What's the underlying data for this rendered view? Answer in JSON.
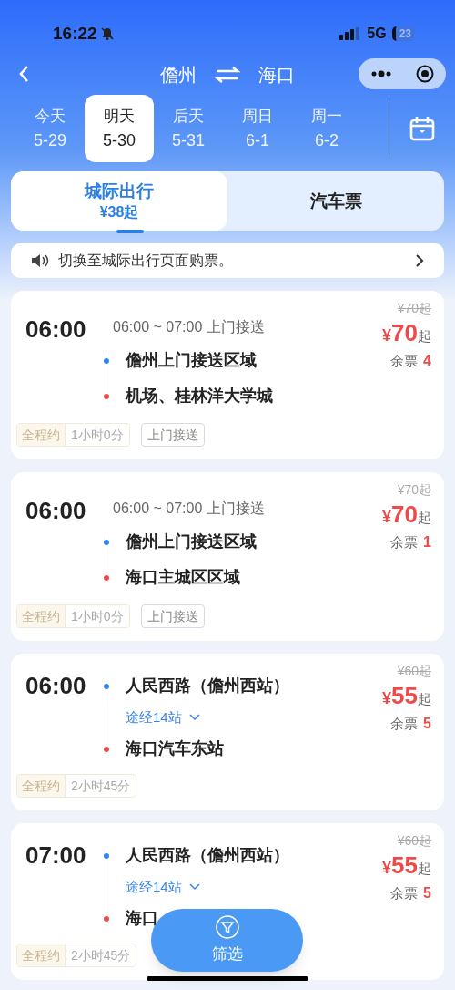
{
  "status_bar": {
    "time": "16:22",
    "network": "5G",
    "battery": "23"
  },
  "header": {
    "from": "儋州",
    "to": "海口"
  },
  "dates": [
    {
      "day": "今天",
      "date": "5-29",
      "selected": false
    },
    {
      "day": "明天",
      "date": "5-30",
      "selected": true
    },
    {
      "day": "后天",
      "date": "5-31",
      "selected": false
    },
    {
      "day": "周日",
      "date": "6-1",
      "selected": false
    },
    {
      "day": "周一",
      "date": "6-2",
      "selected": false
    }
  ],
  "modes": [
    {
      "label": "城际出行",
      "sub": "¥38起",
      "selected": true
    },
    {
      "label": "汽车票",
      "selected": false
    }
  ],
  "notice": "切换至城际出行页面购票。",
  "trips": [
    {
      "time": "06:00",
      "schedule": "06:00 ~ 07:00 上门接送",
      "stops": [
        {
          "name": "儋州上门接送区域",
          "kind": "depart"
        },
        {
          "name": "机场、桂林洋大学城",
          "kind": "arrive"
        }
      ],
      "original_price": "¥70起",
      "currency": "¥",
      "price": "70",
      "price_suffix": "起",
      "remaining_label": "余票",
      "remaining": "4",
      "duration_label": "全程约",
      "duration": "1小时0分",
      "service": "上门接送"
    },
    {
      "time": "06:00",
      "schedule": "06:00 ~ 07:00 上门接送",
      "stops": [
        {
          "name": "儋州上门接送区域",
          "kind": "depart"
        },
        {
          "name": "海口主城区区域",
          "kind": "arrive"
        }
      ],
      "original_price": "¥70起",
      "currency": "¥",
      "price": "70",
      "price_suffix": "起",
      "remaining_label": "余票",
      "remaining": "1",
      "duration_label": "全程约",
      "duration": "1小时0分",
      "service": "上门接送"
    },
    {
      "time": "06:00",
      "stops": [
        {
          "name": "人民西路（儋州西站）",
          "kind": "depart"
        },
        {
          "name": "途经14站",
          "kind": "via"
        },
        {
          "name": "海口汽车东站",
          "kind": "arrive"
        }
      ],
      "original_price": "¥60起",
      "currency": "¥",
      "price": "55",
      "price_suffix": "起",
      "remaining_label": "余票",
      "remaining": "5",
      "duration_label": "全程约",
      "duration": "2小时45分"
    },
    {
      "time": "07:00",
      "stops": [
        {
          "name": "人民西路（儋州西站）",
          "kind": "depart"
        },
        {
          "name": "途经14站",
          "kind": "via"
        },
        {
          "name": "海口",
          "kind": "arrive"
        }
      ],
      "original_price": "¥60起",
      "currency": "¥",
      "price": "55",
      "price_suffix": "起",
      "remaining_label": "余票",
      "remaining": "5",
      "duration_label": "全程约",
      "duration": "2小时45分"
    }
  ],
  "filter_button": "筛选"
}
